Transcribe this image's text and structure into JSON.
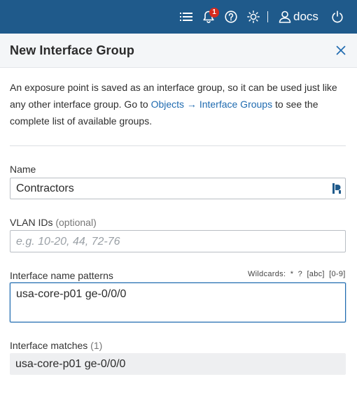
{
  "topbar": {
    "bg_color": "#1f5a8b",
    "icons": [
      "list-icon",
      "bell-icon",
      "help-icon",
      "sun-icon",
      "user-icon",
      "power-icon"
    ],
    "notification_count": "1",
    "user_name": "docs"
  },
  "dialog": {
    "title": "New Interface Group",
    "close_icon": "close-icon"
  },
  "intro": {
    "text_before": "An exposure point is saved as an interface group, so it can be used just like any other interface group. Go to ",
    "link": "Objects → Interface Groups",
    "text_after": " to see the complete list of available groups."
  },
  "form": {
    "name": {
      "label": "Name",
      "value": "Contractors"
    },
    "vlan": {
      "label": "VLAN IDs",
      "label_suffix": "(optional)",
      "placeholder": "e.g. 10-20, 44, 72-76"
    },
    "patterns": {
      "label": "Interface name patterns",
      "wildcards_label": "Wildcards:",
      "wildcards": [
        "*",
        "?",
        "[abc]",
        "[0-9]"
      ],
      "value": "usa-core-p01 ge-0/0/0"
    },
    "matches": {
      "label": "Interface matches",
      "count": "(1)",
      "items": [
        "usa-core-p01 ge-0/0/0"
      ]
    }
  },
  "colors": {
    "accent": "#1f6bb0",
    "badge": "#d52b1e"
  }
}
